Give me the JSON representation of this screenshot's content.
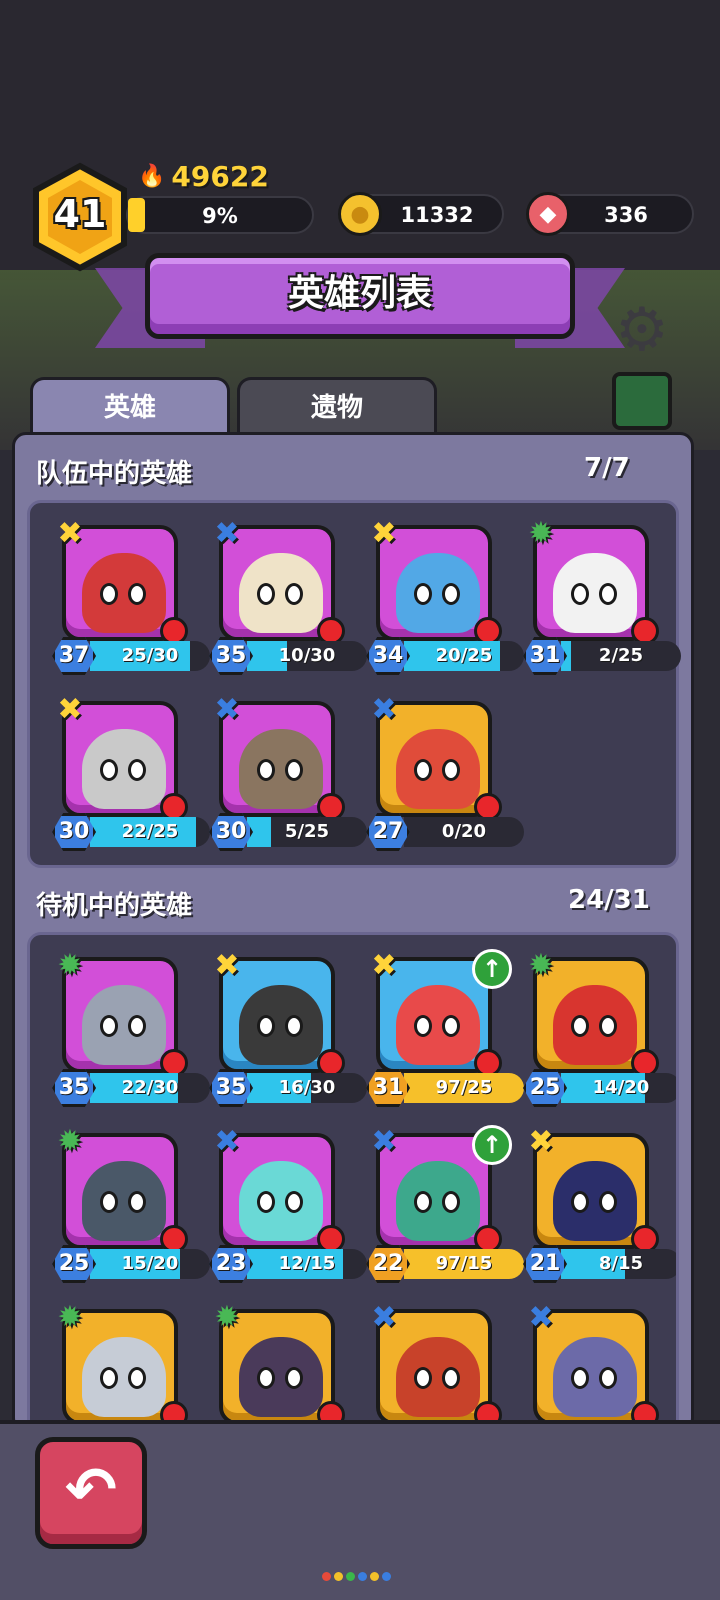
{
  "player": {
    "level": "41",
    "power": "49622",
    "xp_percent_label": "9%",
    "xp_fraction": 0.09
  },
  "resources": {
    "gold": "11332",
    "meat": "336"
  },
  "banner": {
    "title": "英雄列表"
  },
  "tabs": [
    {
      "label": "英雄"
    },
    {
      "label": "遗物"
    }
  ],
  "team": {
    "title": "队伍中的英雄",
    "count": "7/7",
    "heroes": [
      {
        "rank": "gold",
        "frame": "purple",
        "level": "37",
        "progress": "25/30",
        "fill": 0.83,
        "face": "#d33a3a",
        "upgrade": false
      },
      {
        "rank": "blue",
        "frame": "purple",
        "level": "35",
        "progress": "10/30",
        "fill": 0.33,
        "face": "#efe3c8",
        "upgrade": false
      },
      {
        "rank": "gold",
        "frame": "purple",
        "level": "34",
        "progress": "20/25",
        "fill": 0.8,
        "face": "#52a8e6",
        "upgrade": false
      },
      {
        "rank": "green",
        "frame": "purple",
        "level": "31",
        "progress": "2/25",
        "fill": 0.08,
        "face": "#f2f2f2",
        "upgrade": false
      },
      {
        "rank": "gold",
        "frame": "purple",
        "level": "30",
        "progress": "22/25",
        "fill": 0.88,
        "face": "#c9c9c9",
        "upgrade": false
      },
      {
        "rank": "blue",
        "frame": "purple",
        "level": "30",
        "progress": "5/25",
        "fill": 0.2,
        "face": "#8a7560",
        "upgrade": false
      },
      {
        "rank": "blue",
        "frame": "gold",
        "level": "27",
        "progress": "0/20",
        "fill": 0.0,
        "face": "#e04c3a",
        "upgrade": false
      }
    ]
  },
  "bench": {
    "title": "待机中的英雄",
    "count": "24/31",
    "heroes": [
      {
        "rank": "green",
        "frame": "purple",
        "level": "35",
        "progress": "22/30",
        "fill": 0.73,
        "face": "#9aa2b2",
        "upgrade": false
      },
      {
        "rank": "gold",
        "frame": "blue",
        "level": "35",
        "progress": "16/30",
        "fill": 0.53,
        "face": "#3a3a3a",
        "upgrade": false
      },
      {
        "rank": "gold",
        "frame": "blue",
        "level": "31",
        "progress": "97/25",
        "fill": 1.0,
        "face": "#e84a4a",
        "upgrade": true
      },
      {
        "rank": "green",
        "frame": "gold",
        "level": "25",
        "progress": "14/20",
        "fill": 0.7,
        "face": "#d8352f",
        "upgrade": false
      },
      {
        "rank": "green",
        "frame": "purple",
        "level": "25",
        "progress": "15/20",
        "fill": 0.75,
        "face": "#4a5868",
        "upgrade": false
      },
      {
        "rank": "blue",
        "frame": "purple",
        "level": "23",
        "progress": "12/15",
        "fill": 0.8,
        "face": "#6ad9d6",
        "upgrade": false
      },
      {
        "rank": "blue",
        "frame": "purple",
        "level": "22",
        "progress": "97/15",
        "fill": 1.0,
        "face": "#3da88c",
        "upgrade": true
      },
      {
        "rank": "gold",
        "frame": "gold",
        "level": "21",
        "progress": "8/15",
        "fill": 0.53,
        "face": "#2b2e6a",
        "upgrade": false
      },
      {
        "rank": "green",
        "frame": "gold",
        "level": "",
        "progress": "",
        "fill": 0,
        "face": "#c6ccd6",
        "upgrade": false
      },
      {
        "rank": "green",
        "frame": "gold",
        "level": "",
        "progress": "",
        "fill": 0,
        "face": "#4a3a5a",
        "upgrade": false
      },
      {
        "rank": "blue",
        "frame": "gold",
        "level": "",
        "progress": "",
        "fill": 0,
        "face": "#c8422a",
        "upgrade": false
      },
      {
        "rank": "blue",
        "frame": "gold",
        "level": "",
        "progress": "",
        "fill": 0,
        "face": "#6c6aa8",
        "upgrade": false
      }
    ]
  },
  "icons": {
    "power": "flame-icon",
    "gold": "coin-icon",
    "meat": "meat-icon",
    "settings": "gear-icon",
    "mail": "mail-icon",
    "back": "back-arrow-icon"
  },
  "colors": {
    "accent_purple": "#b15fd6",
    "bar_cyan": "#2fc5ec",
    "bar_gold": "#f6c02a",
    "rank_gold": "#ffd43a",
    "rank_blue": "#3a7ee0",
    "rank_green": "#49b855"
  }
}
